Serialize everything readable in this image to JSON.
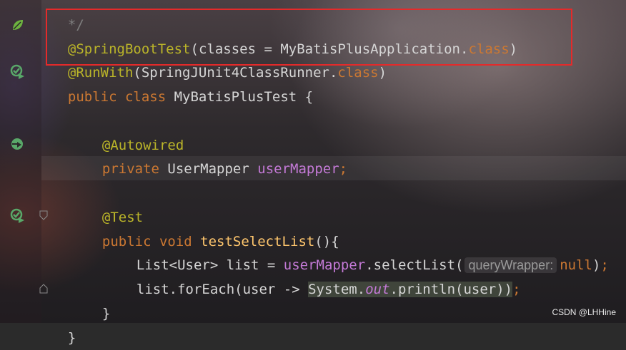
{
  "editor": {
    "comment_end": "*/",
    "annotation1": {
      "at": "@SpringBootTest",
      "open": "(",
      "param": "classes = ",
      "value": "MyBatisPlusApplication",
      "dot": ".",
      "kw": "class",
      "close": ")"
    },
    "annotation2": {
      "at": "@RunWith",
      "open": "(",
      "value": "SpringJUnit4ClassRunner",
      "dot": ".",
      "kw": "class",
      "close": ")"
    },
    "class_decl": {
      "kw_public": "public ",
      "kw_class": "class ",
      "name": "MyBatisPlusTest {"
    },
    "autowired": "@Autowired",
    "field_decl": {
      "kw": "private ",
      "type": "UserMapper ",
      "name": "userMapper",
      "semi": ";"
    },
    "test_ann": "@Test",
    "method_decl": {
      "kw_public": "public ",
      "kw_void": "void ",
      "name": "testSelectList",
      "rest": "(){"
    },
    "stmt1": {
      "type": "List<User> list = ",
      "receiver": "userMapper",
      "call": ".selectList(",
      "hint": "queryWrapper:",
      "kw_null": "null",
      "end": ");",
      "end_semicolon": ";"
    },
    "stmt2": {
      "start": "list.forEach(user -> ",
      "system": "System",
      "dot": ".",
      "out": "out",
      "println": ".println(user))",
      "semi": ";"
    },
    "close_method": "}",
    "close_class": "}"
  },
  "gutter_icons": [
    "spring-leaf-icon",
    "run-test-icon",
    "bean-navigate-icon",
    "run-test-icon"
  ],
  "watermark": "CSDN @LHHine",
  "colors": {
    "keyword": "#cc7832",
    "annotation": "#bbb529",
    "field": "#c47ad7",
    "method": "#ffc66d",
    "highlight_box": "#e52a2a"
  }
}
